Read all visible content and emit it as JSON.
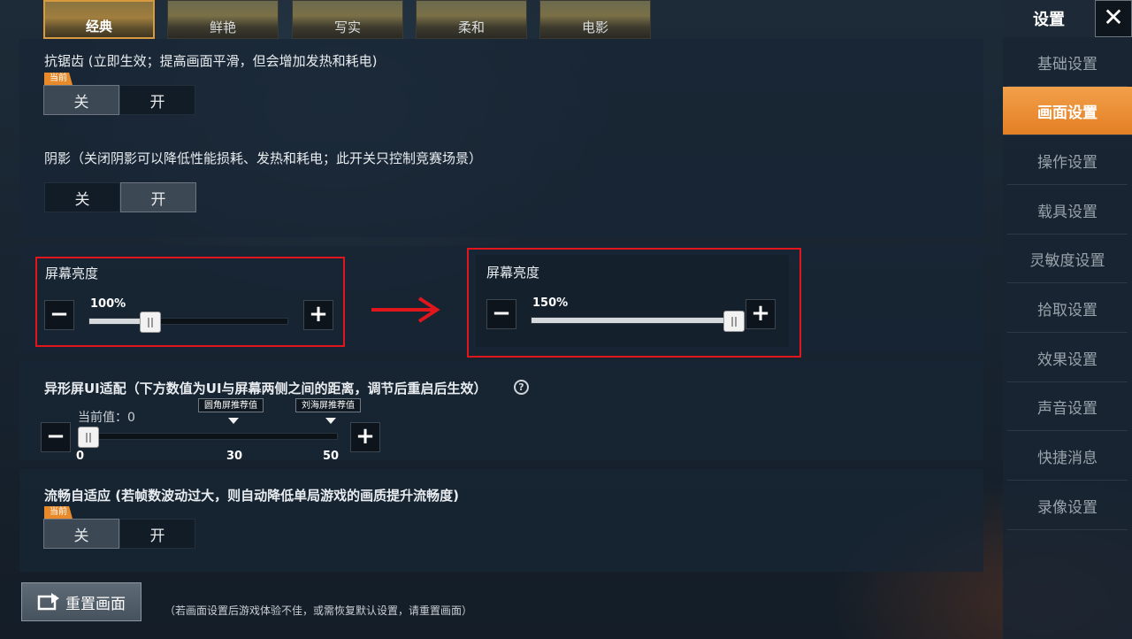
{
  "filters": [
    {
      "label": "经典",
      "selected": true
    },
    {
      "label": "鲜艳",
      "selected": false
    },
    {
      "label": "写实",
      "selected": false
    },
    {
      "label": "柔和",
      "selected": false
    },
    {
      "label": "电影",
      "selected": false
    }
  ],
  "anti_aliasing": {
    "label": "抗锯齿 (立即生效；提高画面平滑，但会增加发热和耗电)",
    "badge": "当前",
    "off": "关",
    "on": "开",
    "value": "off"
  },
  "shadow": {
    "label": "阴影（关闭阴影可以降低性能损耗、发热和耗电；此开关只控制竞赛场景）",
    "off": "关",
    "on": "开",
    "value": "on"
  },
  "brightness_before": {
    "label": "屏幕亮度",
    "value_text": "100%",
    "level": 0.3
  },
  "brightness_after": {
    "label": "屏幕亮度",
    "value_text": "150%",
    "level": 1.0
  },
  "notch_ui": {
    "label": "异形屏UI适配（下方数值为UI与屏幕两侧之间的距离，调节后重启后生效）",
    "help": "?",
    "current": "当前值：0",
    "tag_round": "圆角屏推荐值",
    "tag_notch": "刘海屏推荐值",
    "tick_0": "0",
    "tick_30": "30",
    "tick_50": "50",
    "value": 0
  },
  "smooth": {
    "label": "流畅自适应 (若帧数波动过大，则自动降低单局游戏的画质提升流畅度)",
    "badge": "当前",
    "off": "关",
    "on": "开",
    "value": "off"
  },
  "reset": {
    "label": "重置画面",
    "hint": "（若画面设置后游戏体验不佳，或需恢复默认设置，请重置画面）"
  },
  "sidebar": {
    "title": "设置",
    "close": "✕",
    "items": [
      {
        "label": "基础设置",
        "active": false
      },
      {
        "label": "画面设置",
        "active": true
      },
      {
        "label": "操作设置",
        "active": false
      },
      {
        "label": "载具设置",
        "active": false
      },
      {
        "label": "灵敏度设置",
        "active": false
      },
      {
        "label": "拾取设置",
        "active": false
      },
      {
        "label": "效果设置",
        "active": false
      },
      {
        "label": "声音设置",
        "active": false
      },
      {
        "label": "快捷消息",
        "active": false
      },
      {
        "label": "录像设置",
        "active": false
      }
    ]
  },
  "colors": {
    "accent": "#e8892a",
    "highlight": "#e0161c"
  }
}
